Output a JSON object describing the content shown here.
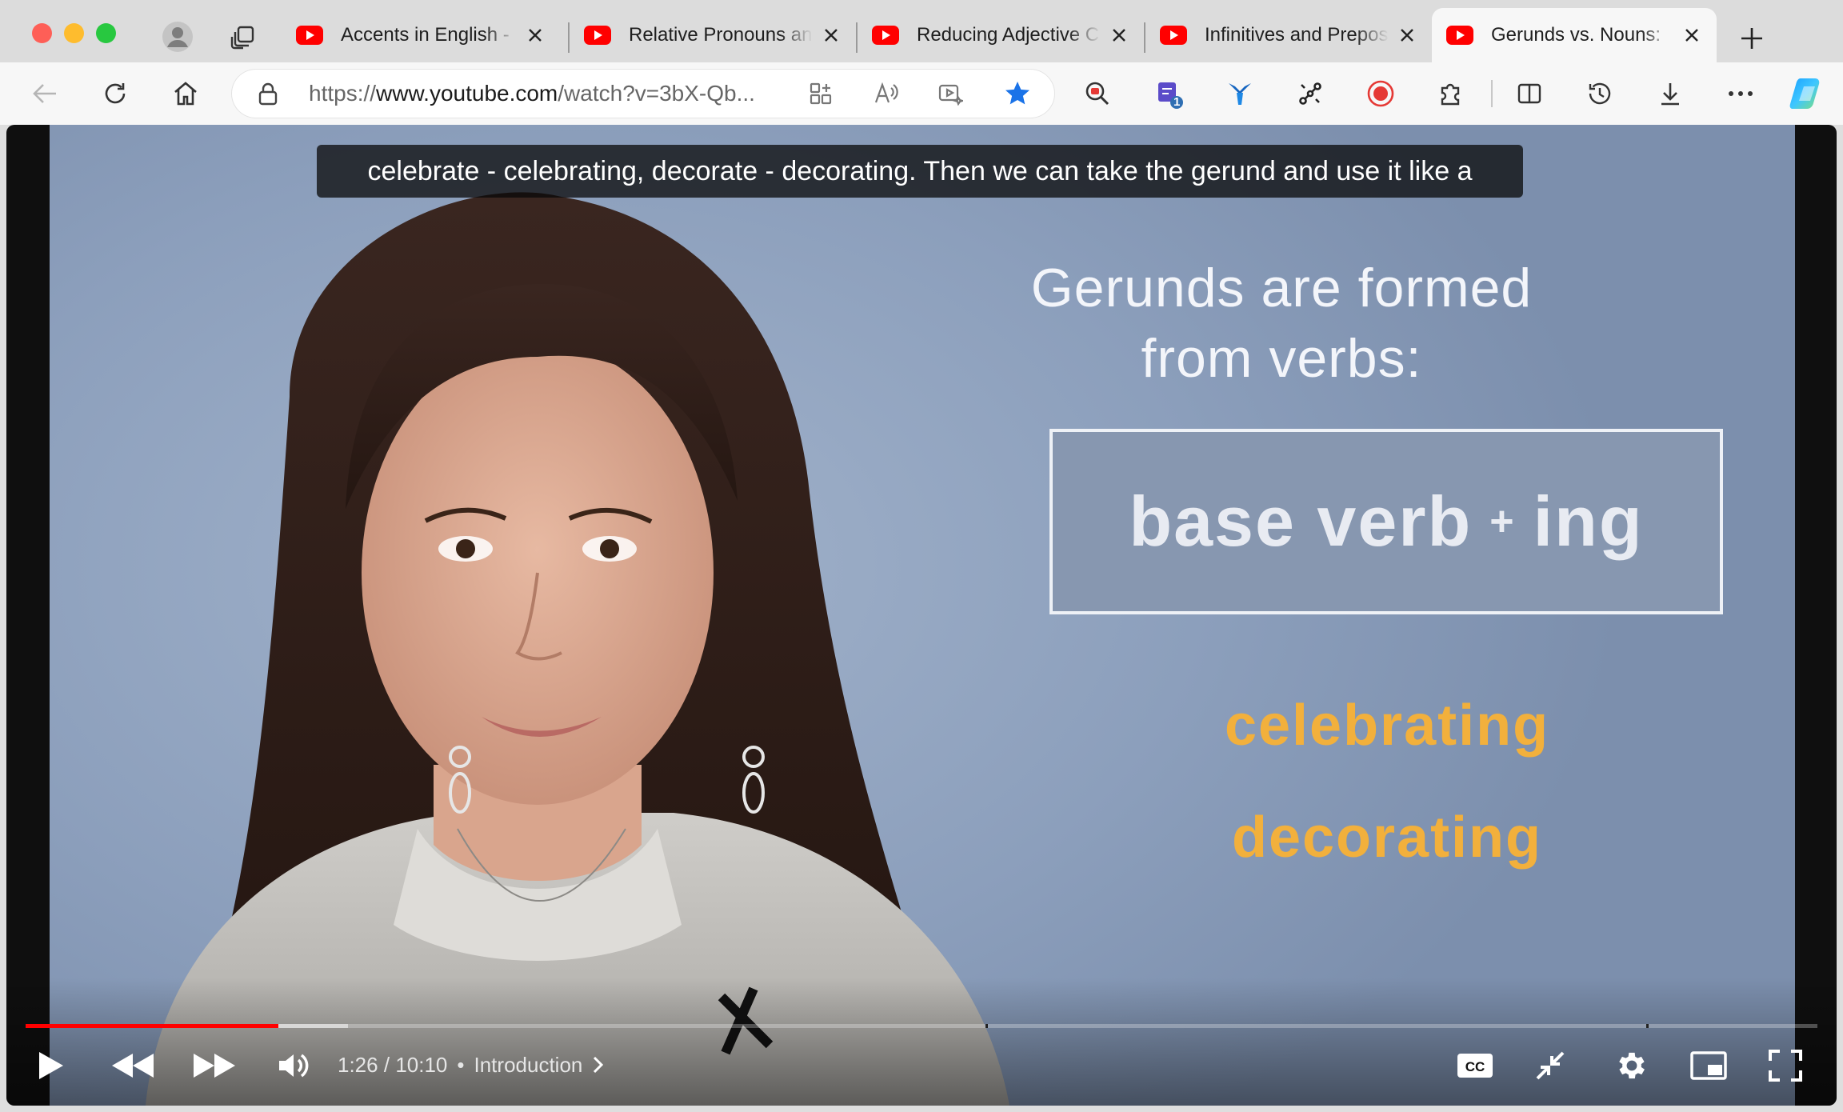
{
  "browser": {
    "tabs": [
      {
        "title": "Accents in English -",
        "active": false
      },
      {
        "title": "Relative Pronouns and",
        "active": false
      },
      {
        "title": "Reducing Adjective Cl",
        "active": false
      },
      {
        "title": "Infinitives and Prepos",
        "active": false
      },
      {
        "title": "Gerunds vs. Nouns:",
        "active": true
      }
    ],
    "url_prefix": "https://",
    "url_main": "www.youtube.com",
    "url_rest": "/watch?v=3bX-Qb...",
    "extension_badge": "1"
  },
  "video": {
    "caption": "celebrate - celebrating, decorate - decorating.  Then we can take the gerund and use it like a",
    "slide": {
      "title_line1": "Gerunds are formed",
      "title_line2": "from verbs:",
      "formula_left": "base verb",
      "formula_plus": "+",
      "formula_right": "ing",
      "example1": "celebrating",
      "example2": "decorating"
    },
    "current_time": "1:26",
    "time_separator": "/",
    "duration": "10:10",
    "chapter_dot": "•",
    "chapter": "Introduction",
    "progress_fraction": 0.141,
    "buffered_fraction": 0.18
  },
  "colors": {
    "accent_red": "#ff0000",
    "youtube_red": "#ff0000",
    "slide_orange": "#f2b03c",
    "favorite_blue": "#1a73e8"
  },
  "icons": [
    "back-arrow-icon",
    "reload-icon",
    "home-icon",
    "lock-icon",
    "apps-icon",
    "read-aloud-icon",
    "video-enhance-icon",
    "star-icon",
    "play-icon",
    "rewind-icon",
    "fast-forward-icon",
    "volume-icon",
    "cc-icon",
    "minimize-icon",
    "settings-icon",
    "miniplayer-icon",
    "fullscreen-icon"
  ]
}
